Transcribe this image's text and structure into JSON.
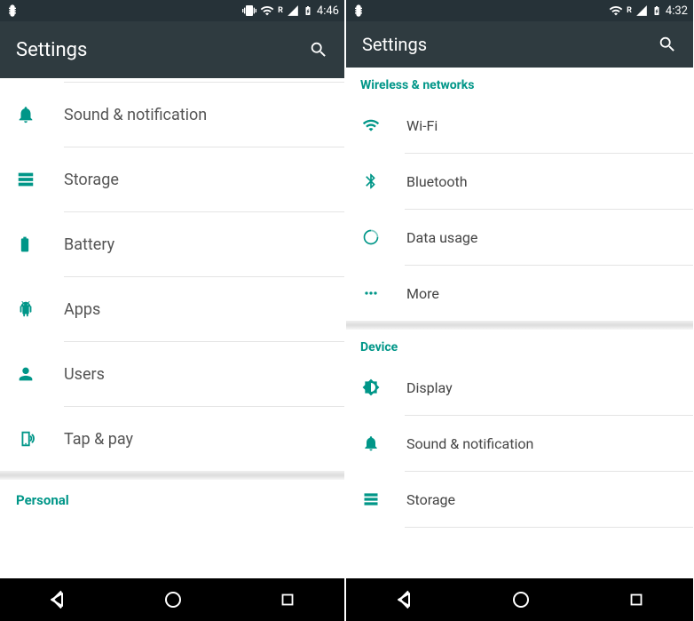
{
  "accent": "#009688",
  "left": {
    "status": {
      "time": "4:46",
      "roaming_indicator": "R"
    },
    "appbar": {
      "title": "Settings"
    },
    "items": [
      {
        "name": "sound-notification",
        "label": "Sound & notification",
        "icon": "bell-icon"
      },
      {
        "name": "storage",
        "label": "Storage",
        "icon": "storage-icon"
      },
      {
        "name": "battery",
        "label": "Battery",
        "icon": "battery-icon"
      },
      {
        "name": "apps",
        "label": "Apps",
        "icon": "android-icon"
      },
      {
        "name": "users",
        "label": "Users",
        "icon": "person-icon"
      },
      {
        "name": "tap-pay",
        "label": "Tap & pay",
        "icon": "tap-pay-icon"
      }
    ],
    "section_after": "Personal"
  },
  "right": {
    "status": {
      "time": "4:32",
      "roaming_indicator": "R"
    },
    "appbar": {
      "title": "Settings"
    },
    "sections": [
      {
        "header": "Wireless & networks",
        "items": [
          {
            "name": "wifi",
            "label": "Wi-Fi",
            "icon": "wifi-icon"
          },
          {
            "name": "bluetooth",
            "label": "Bluetooth",
            "icon": "bluetooth-icon"
          },
          {
            "name": "data-usage",
            "label": "Data usage",
            "icon": "data-usage-icon"
          },
          {
            "name": "more",
            "label": "More",
            "icon": "more-icon"
          }
        ]
      },
      {
        "header": "Device",
        "items": [
          {
            "name": "display",
            "label": "Display",
            "icon": "brightness-icon"
          },
          {
            "name": "sound-notification",
            "label": "Sound & notification",
            "icon": "bell-icon"
          },
          {
            "name": "storage",
            "label": "Storage",
            "icon": "storage-icon"
          }
        ]
      }
    ]
  }
}
